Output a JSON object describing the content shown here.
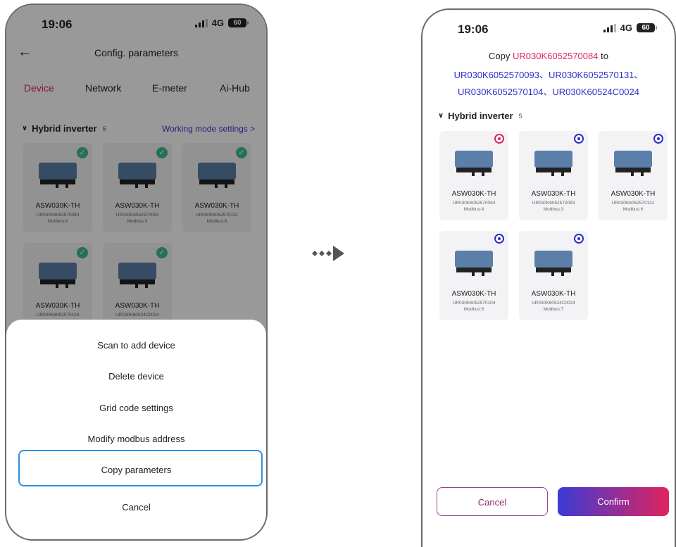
{
  "left_screen": {
    "status": {
      "time": "19:06",
      "network": "4G",
      "battery": "60"
    },
    "nav": {
      "title": "Config. parameters"
    },
    "tabs": [
      "Device",
      "Network",
      "E-meter",
      "Ai-Hub"
    ],
    "section": {
      "title": "Hybrid inverter",
      "count": "5",
      "link": "Working mode settings >"
    },
    "devices": [
      {
        "model": "ASW030K-TH",
        "sn": "UR030K6052570084",
        "modbus": "Modbus:4"
      },
      {
        "model": "ASW030K-TH",
        "sn": "UR030K6052570093",
        "modbus": "Modbus:3"
      },
      {
        "model": "ASW030K-TH",
        "sn": "UR030K6052570131",
        "modbus": "Modbus:6"
      },
      {
        "model": "ASW030K-TH",
        "sn": "UR030K6052570104",
        "modbus": ""
      },
      {
        "model": "ASW030K-TH",
        "sn": "UR030K60524C0024",
        "modbus": ""
      }
    ],
    "sheet": [
      "Scan to add device",
      "Delete device",
      "Grid code settings",
      "Modify modbus address",
      "Copy parameters",
      "Cancel"
    ]
  },
  "right_screen": {
    "status": {
      "time": "19:06",
      "network": "4G",
      "battery": "60"
    },
    "copy": {
      "prefix": "Copy",
      "source": "UR030K6052570084",
      "to": "to",
      "line2": "UR030K6052570093、UR030K6052570131、",
      "line3": "UR030K6052570104、UR030K60524C0024"
    },
    "section": {
      "title": "Hybrid inverter",
      "count": "5"
    },
    "devices": [
      {
        "model": "ASW030K-TH",
        "sn": "UR030K6052570084",
        "modbus": "Modbus:4"
      },
      {
        "model": "ASW030K-TH",
        "sn": "UR030K6052570093",
        "modbus": "Modbus:3"
      },
      {
        "model": "ASW030K-TH",
        "sn": "UR030K6052570131",
        "modbus": "Modbus:6"
      },
      {
        "model": "ASW030K-TH",
        "sn": "UR030K6052570104",
        "modbus": "Modbus:5"
      },
      {
        "model": "ASW030K-TH",
        "sn": "UR030K60524C0024",
        "modbus": "Modbus:7"
      }
    ],
    "buttons": {
      "cancel": "Cancel",
      "confirm": "Confirm"
    }
  },
  "colors": {
    "accent_red": "#e0245e",
    "accent_blue": "#2d2dc8",
    "check_green": "#3dbb93",
    "highlight": "#2d8fe0"
  }
}
